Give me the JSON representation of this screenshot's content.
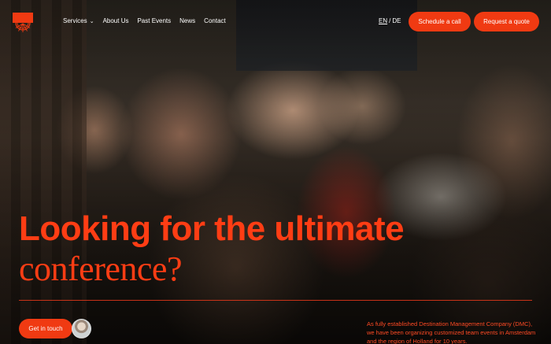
{
  "header": {
    "nav": [
      {
        "label": "Services",
        "has_dropdown": true
      },
      {
        "label": "About Us"
      },
      {
        "label": "Past Events"
      },
      {
        "label": "News"
      },
      {
        "label": "Contact"
      }
    ],
    "lang": {
      "en": "EN",
      "separator": "/",
      "de": "DE",
      "active": "EN"
    },
    "schedule_label": "Schedule a call",
    "quote_label": "Request a quote"
  },
  "hero": {
    "headline": "Looking for the ultimate",
    "subline": "conference?",
    "cta_label": "Get in touch",
    "intro": "As fully established Destination Management Company (DMC), we have been organizing customized team events in Amsterdam and the region of Holland for 10 years."
  },
  "colors": {
    "accent": "#f03a12",
    "headline": "#ff3d14",
    "text": "#ffffff"
  },
  "icons": {
    "logo": "sunrise-logo-icon",
    "dropdown": "chevron-down-icon"
  }
}
